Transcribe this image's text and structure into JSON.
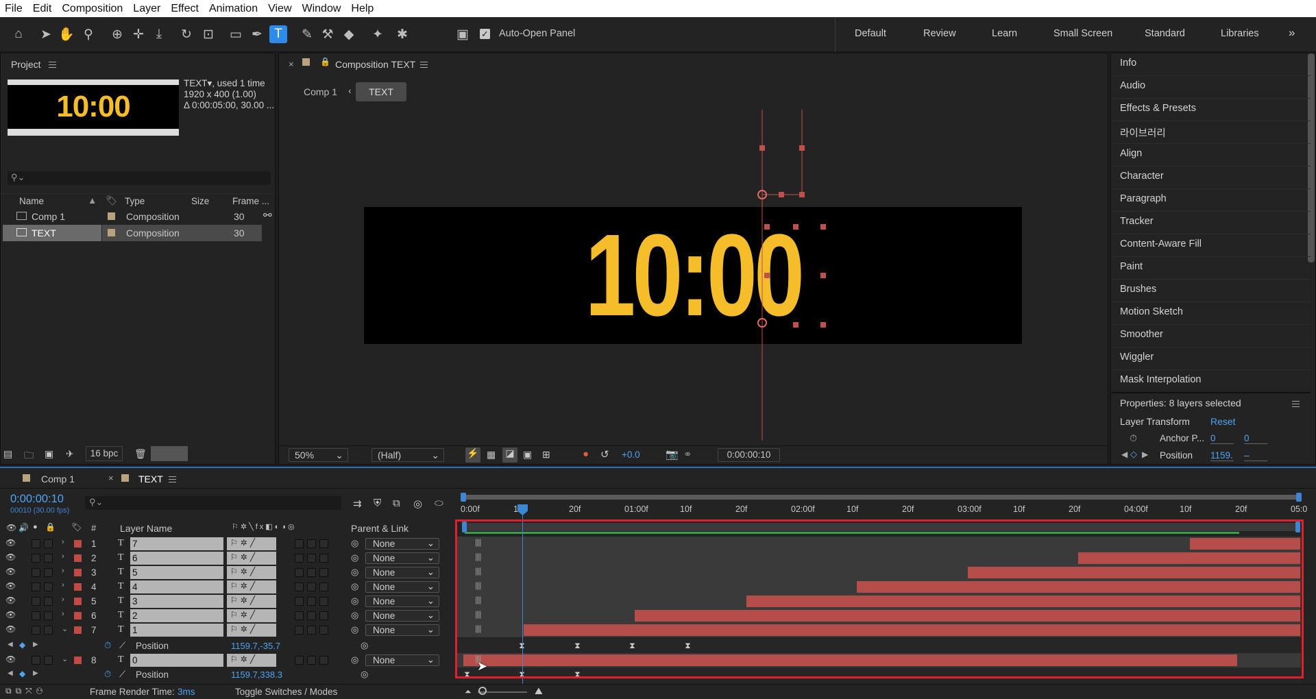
{
  "menu": [
    "File",
    "Edit",
    "Composition",
    "Layer",
    "Effect",
    "Animation",
    "View",
    "Window",
    "Help"
  ],
  "toolbar": {
    "auto_open_label": "Auto-Open Panel",
    "workspaces": [
      "Default",
      "Review",
      "Learn",
      "Small Screen",
      "Standard",
      "Libraries"
    ],
    "more": "»"
  },
  "project": {
    "title": "Project",
    "item_name": "TEXT",
    "item_used": ", used 1 time",
    "item_dims": "1920 x 400 (1.00)",
    "item_duration": "Δ 0:00:05:00, 30.00 ...",
    "thumb_text": "10:00",
    "columns": {
      "name": "Name",
      "type": "Type",
      "size": "Size",
      "frame": "Frame ..."
    },
    "rows": [
      {
        "name": "Comp 1",
        "type": "Composition",
        "frame": "30"
      },
      {
        "name": "TEXT",
        "type": "Composition",
        "frame": "30"
      }
    ],
    "bpc": "16 bpc"
  },
  "viewer": {
    "title": "Composition TEXT",
    "crumb_parent": "Comp 1",
    "crumb_current": "TEXT",
    "comp_text": "10:00",
    "zoom": "50%",
    "resolution": "(Half)",
    "exposure": "+0.0",
    "timecode": "0:00:00:10"
  },
  "right_panel": {
    "items": [
      "Info",
      "Audio",
      "Effects & Presets",
      "라이브러리",
      "Align",
      "Character",
      "Paragraph",
      "Tracker",
      "Content-Aware Fill",
      "Paint",
      "Brushes",
      "Motion Sketch",
      "Smoother",
      "Wiggler",
      "Mask Interpolation"
    ],
    "properties_title": "Properties: 8 layers selected",
    "layer_transform": "Layer Transform",
    "reset": "Reset",
    "anchor_label": "Anchor P...",
    "anchor_x": "0",
    "anchor_y": "0",
    "position_label": "Position",
    "position_x": "1159.",
    "position_y": "–"
  },
  "timeline": {
    "tabs": [
      {
        "label": "Comp 1"
      },
      {
        "label": "TEXT"
      }
    ],
    "timecode": "0:00:00:10",
    "frames": "00010 (30.00 fps)",
    "col_layer_name": "Layer Name",
    "col_hash": "#",
    "col_parent": "Parent & Link",
    "ruler": [
      "0:00f",
      "10f",
      "20f",
      "01:00f",
      "10f",
      "20f",
      "02:00f",
      "10f",
      "20f",
      "03:00f",
      "10f",
      "20f",
      "04:00f",
      "10f",
      "20f",
      "05:0"
    ],
    "layers": [
      {
        "num": "1",
        "name": "7",
        "parent": "None",
        "bar_start": 0.868,
        "bar_end": 1.0
      },
      {
        "num": "2",
        "name": "6",
        "parent": "None",
        "bar_start": 0.735,
        "bar_end": 1.0
      },
      {
        "num": "3",
        "name": "5",
        "parent": "None",
        "bar_start": 0.603,
        "bar_end": 1.0
      },
      {
        "num": "4",
        "name": "4",
        "parent": "None",
        "bar_start": 0.47,
        "bar_end": 1.0
      },
      {
        "num": "5",
        "name": "3",
        "parent": "None",
        "bar_start": 0.338,
        "bar_end": 1.0
      },
      {
        "num": "6",
        "name": "2",
        "parent": "None",
        "bar_start": 0.205,
        "bar_end": 1.0
      },
      {
        "num": "7",
        "name": "1",
        "parent": "None",
        "bar_start": 0.072,
        "bar_end": 1.0
      },
      {
        "num": "8",
        "name": "0",
        "parent": "None",
        "bar_start": 0.0,
        "bar_end": 0.925
      }
    ],
    "prop1_label": "Position",
    "prop1_value": "1159.7,-35.7",
    "prop2_label": "Position",
    "prop2_value": "1159.7,338.3",
    "render_label": "Frame Render Time:",
    "render_value": "3ms",
    "toggle_label": "Toggle Switches / Modes"
  },
  "colors": {
    "accent": "#2d8ceb",
    "layer_label": "#c24a44",
    "comp_text": "#f5bd2a",
    "highlight": "#e0202a",
    "workarea": "#3aa048"
  }
}
